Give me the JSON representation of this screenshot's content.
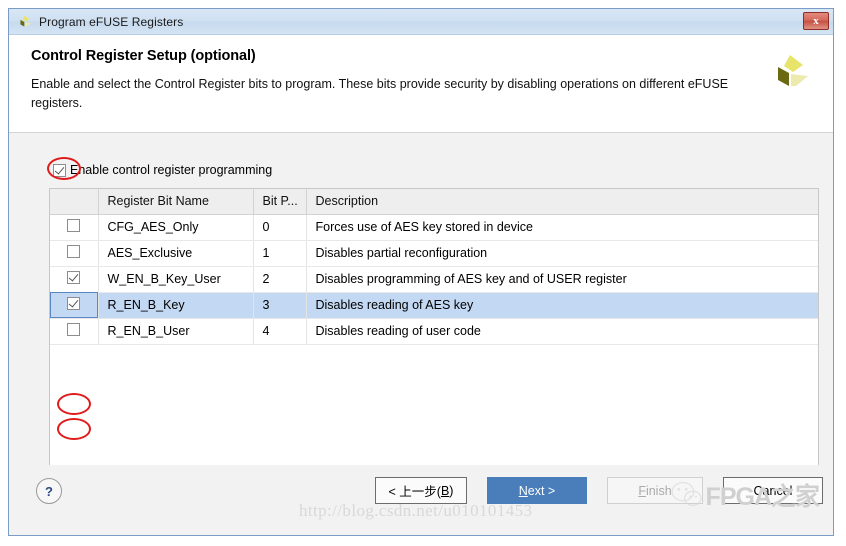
{
  "window": {
    "title": "Program eFUSE Registers",
    "close_label": "x",
    "logo_icon": "xilinx-logo-icon"
  },
  "header": {
    "title": "Control Register Setup (optional)",
    "subtitle": "Enable and select the Control Register bits to program. These bits provide security by disabling operations on different eFUSE registers.",
    "logo_icon": "xilinx-logo-icon"
  },
  "enable": {
    "label": "Enable control register programming",
    "checked": true
  },
  "table": {
    "columns": [
      "",
      "Register Bit Name",
      "Bit P...",
      "Description"
    ],
    "rows": [
      {
        "checked": false,
        "name": "CFG_AES_Only",
        "bit": "0",
        "description": "Forces use of AES key stored in device",
        "selected": false
      },
      {
        "checked": false,
        "name": "AES_Exclusive",
        "bit": "1",
        "description": "Disables partial reconfiguration",
        "selected": false
      },
      {
        "checked": true,
        "name": "W_EN_B_Key_User",
        "bit": "2",
        "description": "Disables programming of AES key and of USER register",
        "selected": false
      },
      {
        "checked": true,
        "name": "R_EN_B_Key",
        "bit": "3",
        "description": "Disables reading of AES key",
        "selected": true
      },
      {
        "checked": false,
        "name": "R_EN_B_User",
        "bit": "4",
        "description": "Disables reading of user code",
        "selected": false
      }
    ]
  },
  "scrollbar": {
    "left_arrow": "‹",
    "right_arrow": "›"
  },
  "footer": {
    "help_label": "?",
    "back_label_pre": "< 上一步(",
    "back_label_key": "B",
    "back_label_post": ")",
    "next_label_key": "N",
    "next_label_post": "ext >",
    "finish_label_key": "F",
    "finish_label_post": "inish",
    "cancel_label": "Cancel"
  },
  "watermark": {
    "url": "http://blog.csdn.net/u010101453",
    "brand": "FPGA之家",
    "brand_icon": "wechat-icon"
  },
  "colors": {
    "accent_blue": "#4a7ebb",
    "selection_blue": "#c3d8f2",
    "annotation_red": "#e01b1b",
    "titlebar_blue": "#cfe0f2",
    "close_red": "#c4503f"
  }
}
